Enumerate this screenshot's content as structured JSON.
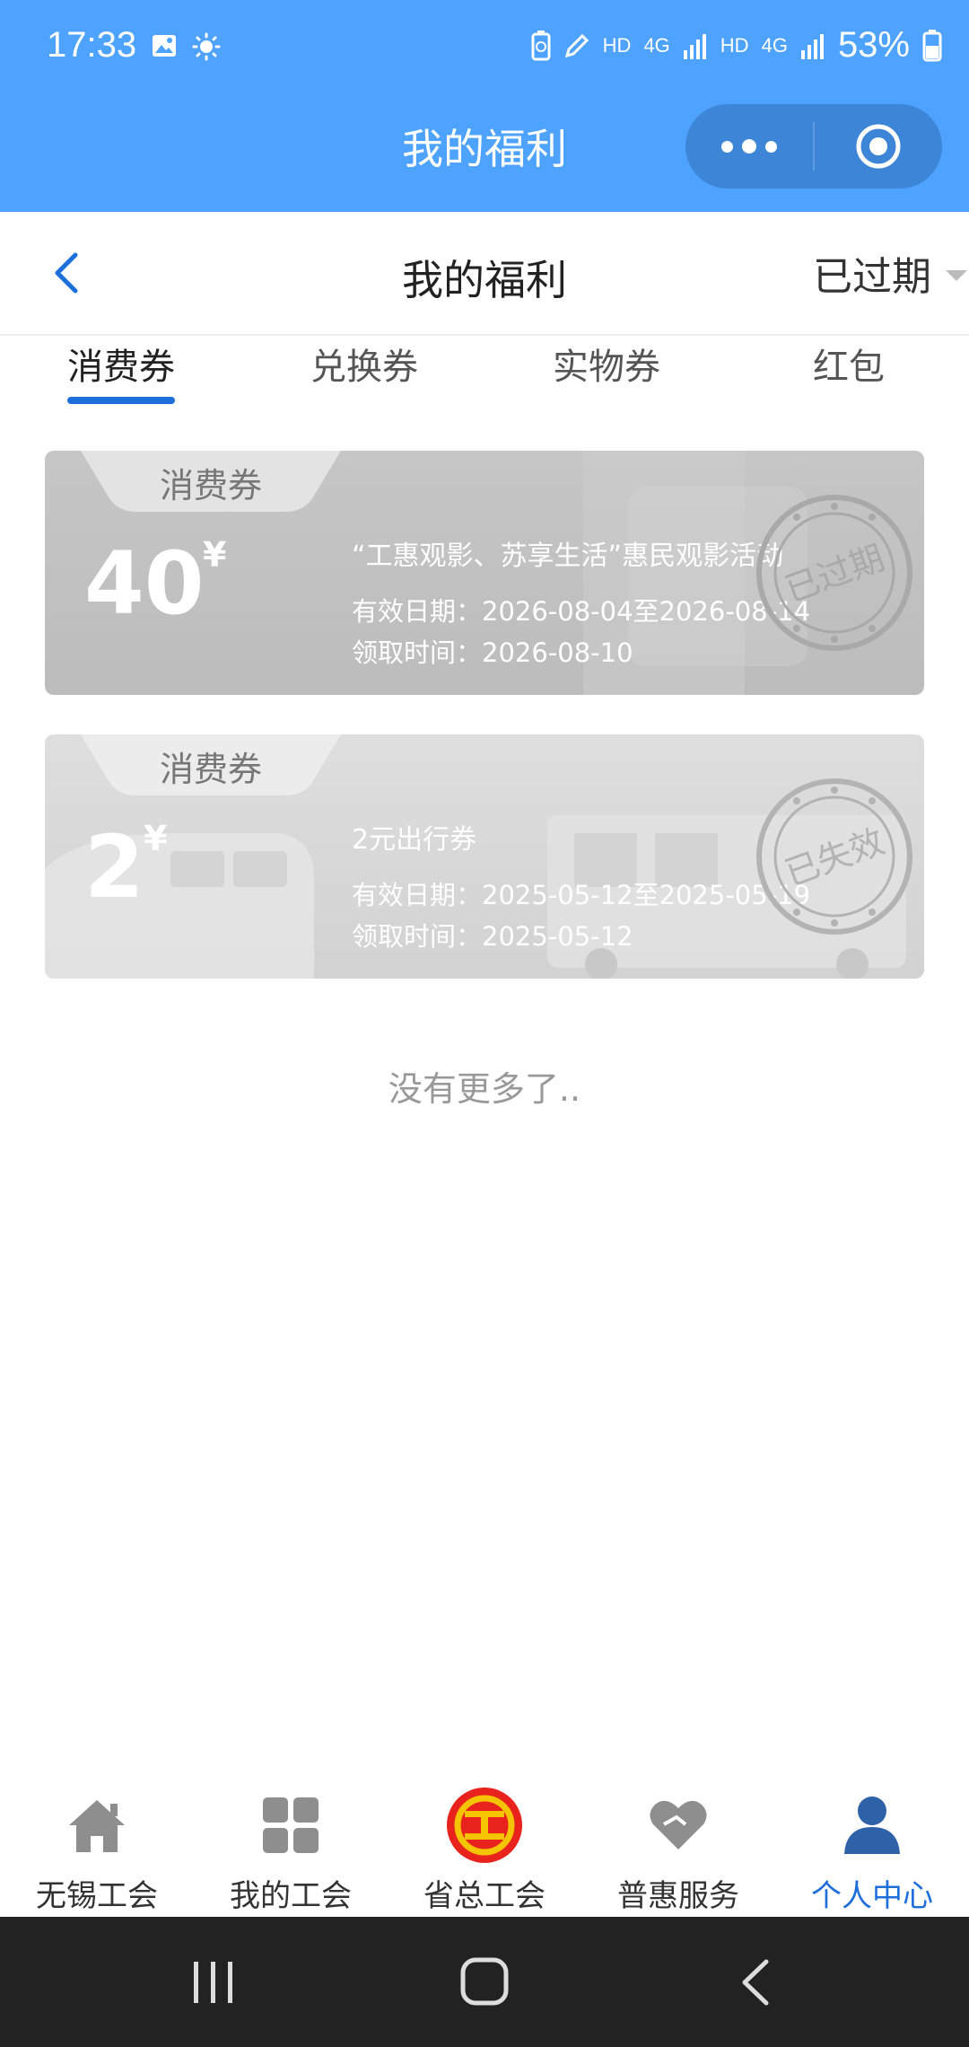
{
  "status_bar": {
    "time": "17:33",
    "network_1": "HD",
    "network_2": "4G",
    "network_3": "HD",
    "network_4": "4G",
    "battery": "53%"
  },
  "mini_program": {
    "title": "我的福利"
  },
  "nav": {
    "title": "我的福利",
    "filter_label": "已过期"
  },
  "tabs": [
    {
      "label": "消费券",
      "active": true
    },
    {
      "label": "兑换券",
      "active": false
    },
    {
      "label": "实物券",
      "active": false
    },
    {
      "label": "红包",
      "active": false
    }
  ],
  "coupons": [
    {
      "type_tag": "消费券",
      "amount": "40",
      "currency": "¥",
      "title": "“工惠观影、苏享生活”惠民观影活动",
      "valid_text": "有效日期：2026-08-04至2026-08-14",
      "received_text": "领取时间：2026-08-10",
      "stamp": "已过期"
    },
    {
      "type_tag": "消费券",
      "amount": "2",
      "currency": "¥",
      "title": "2元出行券",
      "valid_text": "有效日期：2025-05-12至2025-05-19",
      "received_text": "领取时间：2025-05-12",
      "stamp": "已失效"
    }
  ],
  "list_footer": "没有更多了..",
  "tabbar": [
    {
      "label": "无锡工会",
      "icon": "home-icon",
      "active": false
    },
    {
      "label": "我的工会",
      "icon": "grid-icon",
      "active": false
    },
    {
      "label": "省总工会",
      "icon": "union-logo-icon",
      "active": false
    },
    {
      "label": "普惠服务",
      "icon": "heart-icon",
      "active": false
    },
    {
      "label": "个人中心",
      "icon": "person-icon",
      "active": true
    }
  ],
  "colors": {
    "header_blue": "#4da3ff",
    "accent_blue": "#1e6fdc",
    "union_red": "#e8231e",
    "union_yellow": "#f5c400"
  }
}
